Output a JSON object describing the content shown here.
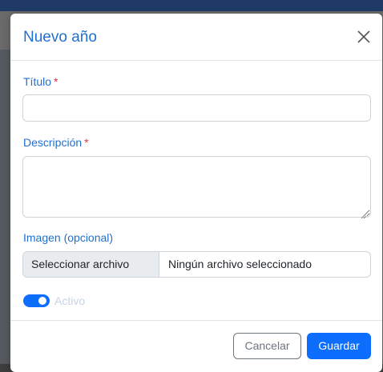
{
  "modal": {
    "title": "Nuevo año",
    "close_icon": "close-icon"
  },
  "form": {
    "title_label": "Título",
    "title_required": "*",
    "title_value": "",
    "description_label": "Descripción",
    "description_required": "*",
    "description_value": "",
    "image_label": "Imagen (opcional)",
    "file_button_label": "Seleccionar archivo",
    "file_status": "Ningún archivo seleccionado",
    "active_label": "Activo",
    "active_on": true
  },
  "footer": {
    "cancel_label": "Cancelar",
    "save_label": "Guardar"
  },
  "colors": {
    "accent": "#1f6fd1",
    "primary": "#0d6efd",
    "required": "#dc3545"
  }
}
